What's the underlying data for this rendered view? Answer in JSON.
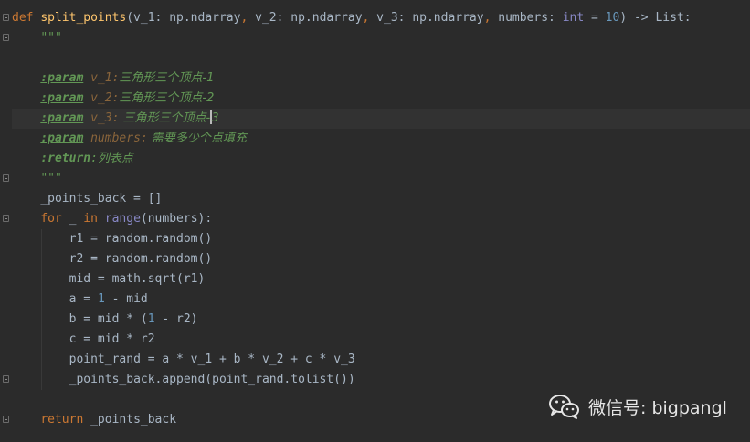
{
  "code": {
    "line_def": {
      "kw_def": "def",
      "fn_name": "split_points",
      "open": "(v_1: np.ndarray",
      "c1": ",",
      "p2": " v_2: np.ndarray",
      "c2": ",",
      "p3": " v_3: np.ndarray",
      "c3": ",",
      "p4": " numbers: ",
      "int_type": "int",
      "eq": " = ",
      "default": "10",
      "ret": ") -> List:"
    },
    "doc_open": "\"\"\"",
    "doc_p1": {
      "tag": ":param",
      "name": " v_1:",
      "desc": "三角形三个顶点-1"
    },
    "doc_p2": {
      "tag": ":param",
      "name": " v_2:",
      "desc": "三角形三个顶点-2"
    },
    "doc_p3": {
      "tag": ":param",
      "name": " v_3:",
      "desc_before": " 三角形三个顶点-",
      "desc_after": "3"
    },
    "doc_p4": {
      "tag": ":param",
      "name": " numbers:",
      "desc": " 需要多少个点填充"
    },
    "doc_ret": {
      "tag": ":return",
      "colon": ":",
      "desc": "列表点"
    },
    "doc_close": "\"\"\"",
    "l_points_back": "_points_back = []",
    "l_for": {
      "kw_for": "for",
      "mid": " _ ",
      "kw_in": "in",
      "sp": " ",
      "bi_range": "range",
      "rest": "(numbers):"
    },
    "l_r1": "r1 = random.random()",
    "l_r2": "r2 = random.random()",
    "l_mid": "mid = math.sqrt(r1)",
    "l_a": {
      "pre": "a = ",
      "n": "1",
      "post": " - mid"
    },
    "l_b": {
      "pre": "b = mid * (",
      "n": "1",
      "post": " - r2)"
    },
    "l_c": "c = mid * r2",
    "l_point": "point_rand = a * v_1 + b * v_2 + c * v_3",
    "l_append": "_points_back.append(point_rand.tolist())",
    "l_return": {
      "kw_return": "return",
      "rest": " _points_back"
    }
  },
  "watermark": {
    "text": "微信号: bigpangl",
    "icon": "wechat-icon"
  },
  "colors": {
    "background": "#2b2b2b",
    "keyword": "#cc7832",
    "function": "#ffc66d",
    "number": "#6897bb",
    "docstring": "#629755",
    "builtin": "#8888c6"
  }
}
